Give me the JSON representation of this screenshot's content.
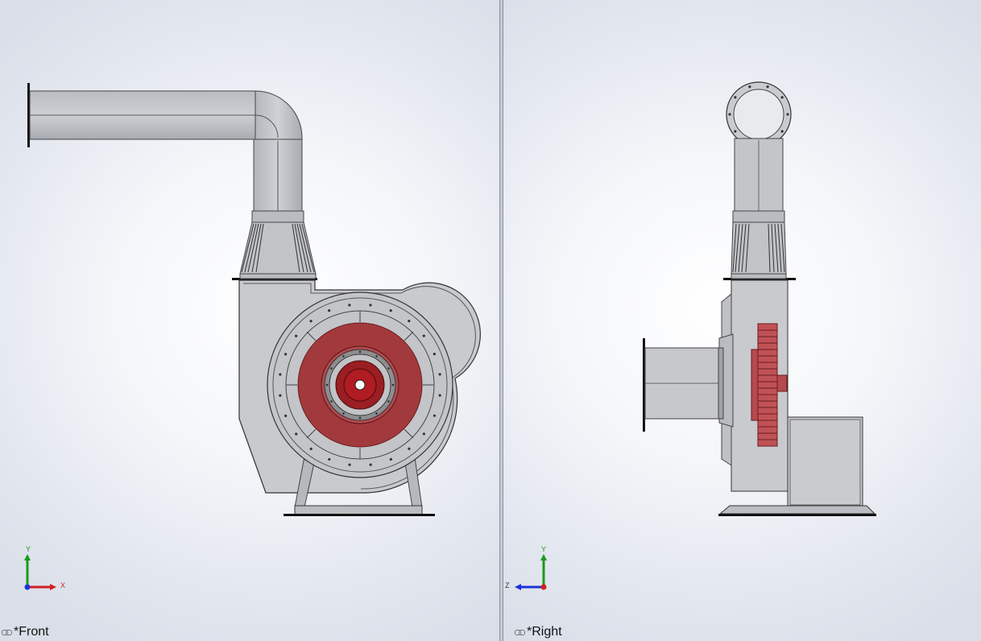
{
  "viewports": {
    "left": {
      "label": "*Front",
      "triad": {
        "up_axis": "Y",
        "right_axis": "X"
      }
    },
    "right": {
      "label": "*Right",
      "triad": {
        "up_axis": "Y",
        "left_axis": "Z"
      }
    }
  },
  "colors": {
    "body_gray": "#c4c6ca",
    "body_gray_dark": "#9fa2a7",
    "impeller_red": "#a22a2e",
    "impeller_red_dark": "#7d1518",
    "axis_x": "#d42020",
    "axis_y": "#1a9a1a",
    "axis_z": "#1c32d8"
  },
  "icons": [
    "link-icon",
    "coordinate-triad-icon"
  ]
}
